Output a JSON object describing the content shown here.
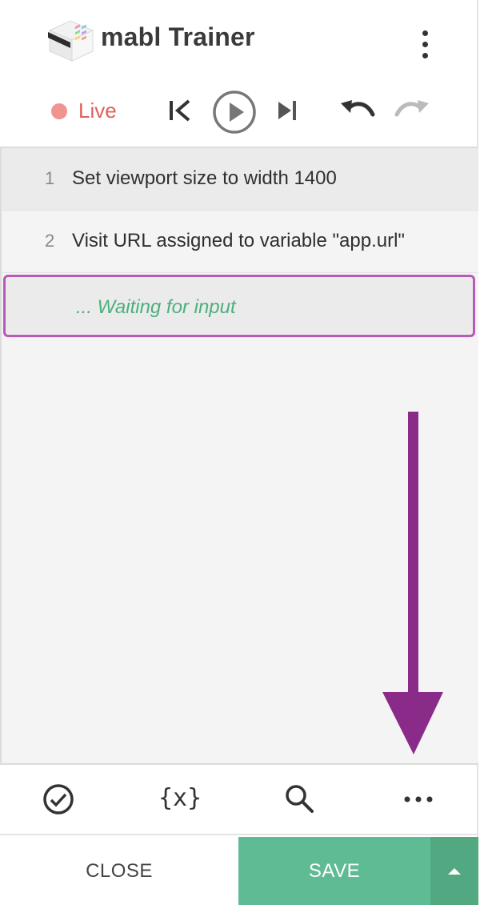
{
  "header": {
    "title": "mabl Trainer",
    "menu_icon": "kebab-menu-icon"
  },
  "toolbar": {
    "live_label": "Live",
    "live_color": "#e0605a",
    "icons": [
      "skip-to-start-icon",
      "play-icon",
      "step-forward-icon",
      "undo-icon",
      "redo-icon"
    ]
  },
  "steps": [
    {
      "number": "1",
      "text": "Set viewport size to width 1400"
    },
    {
      "number": "2",
      "text": "Visit URL assigned to variable \"app.url\""
    }
  ],
  "waiting": {
    "text": "... Waiting for input",
    "border_color": "#b85ab8",
    "text_color": "#4caf7d"
  },
  "bottom_bar": {
    "variables_label": "{x}",
    "icons": [
      "assertion-check-icon",
      "variables-icon",
      "search-icon",
      "more-options-icon"
    ]
  },
  "footer": {
    "close_label": "CLOSE",
    "save_label": "SAVE",
    "save_color": "#5fbb93"
  },
  "annotation": {
    "arrow_color": "#8a2b8a"
  }
}
